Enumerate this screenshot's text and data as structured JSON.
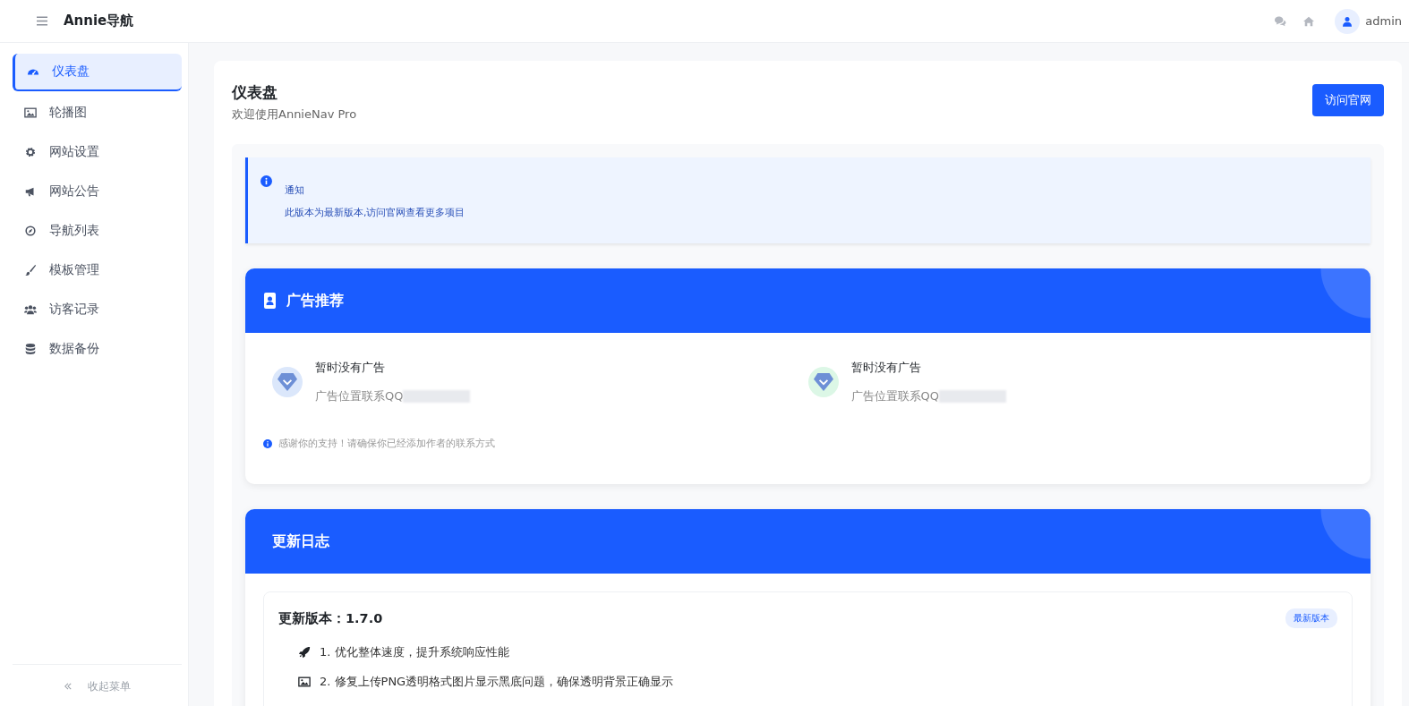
{
  "header": {
    "brand": "Annie导航",
    "user": "admin"
  },
  "sidebar": {
    "items": [
      {
        "label": "仪表盘",
        "selected": true
      },
      {
        "label": "轮播图",
        "selected": false
      },
      {
        "label": "网站设置",
        "selected": false
      },
      {
        "label": "网站公告",
        "selected": false
      },
      {
        "label": "导航列表",
        "selected": false
      },
      {
        "label": "模板管理",
        "selected": false
      },
      {
        "label": "访客记录",
        "selected": false
      },
      {
        "label": "数据备份",
        "selected": false
      }
    ],
    "collapse": "收起菜单"
  },
  "page": {
    "title": "仪表盘",
    "subtitle": "欢迎使用AnnieNav Pro",
    "button": "访问官网"
  },
  "notice": {
    "title": "通知",
    "text": "此版本为最新版本,访问官网查看更多项目"
  },
  "ads": {
    "title": "广告推荐",
    "items": [
      {
        "title": "暂时没有广告",
        "text": "广告位置联系QQ",
        "color": "#dbe7fb"
      },
      {
        "title": "暂时没有广告",
        "text": "广告位置联系QQ",
        "color": "#dcf7e6"
      }
    ],
    "footnote": "感谢你的支持！请确保你已经添加作者的联系方式"
  },
  "changelog": {
    "title": "更新日志",
    "version": "更新版本：1.7.0",
    "badge": "最新版本",
    "items": [
      {
        "text": "1. 优化整体速度，提升系统响应性能"
      },
      {
        "text": "2. 修复上传PNG透明格式图片显示黑底问题，确保透明背景正确显示"
      }
    ]
  }
}
